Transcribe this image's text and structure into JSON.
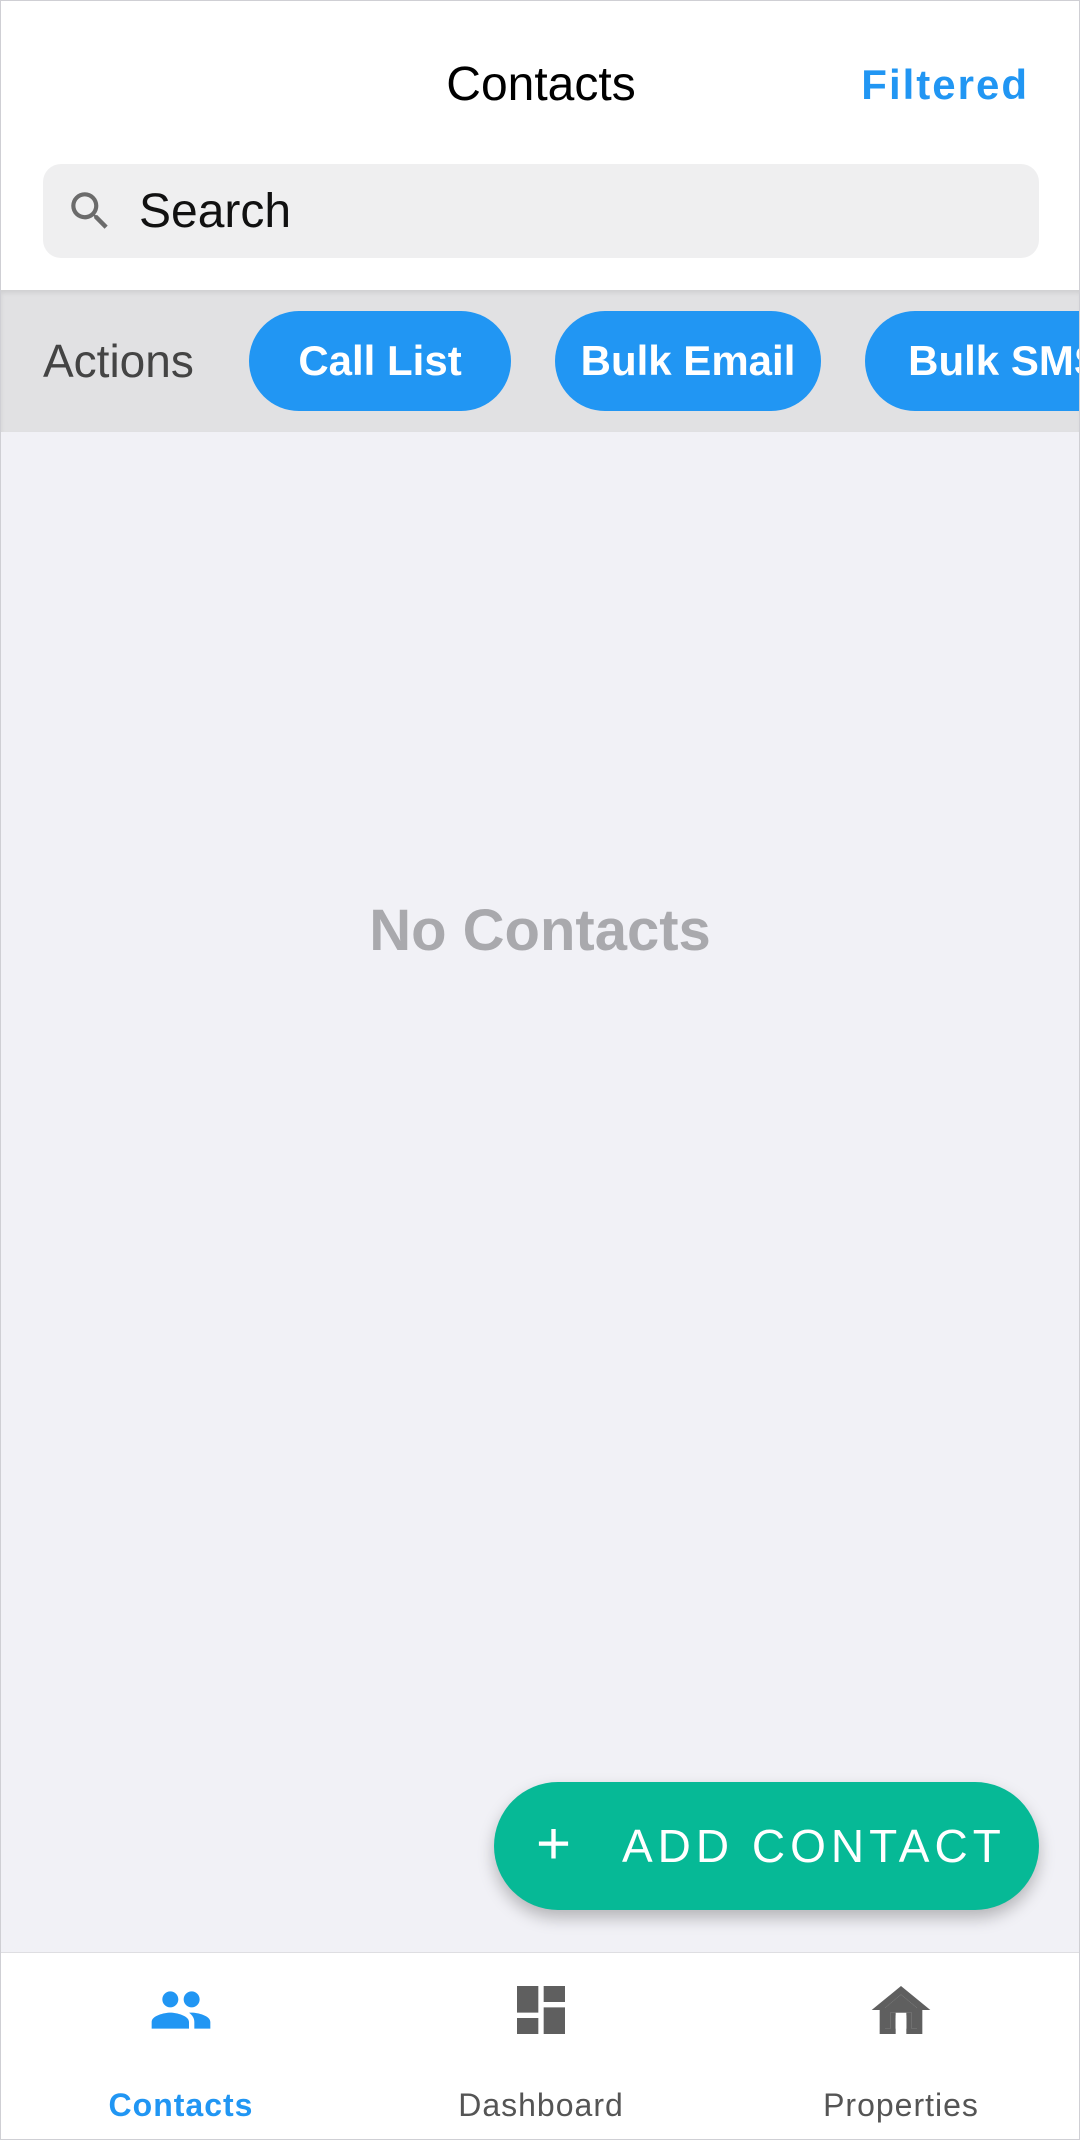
{
  "header": {
    "title": "Contacts",
    "filter_label": "Filtered"
  },
  "search": {
    "placeholder": "Search",
    "value": ""
  },
  "actions": {
    "label": "Actions",
    "buttons": [
      "Call List",
      "Bulk Email",
      "Bulk SMS"
    ]
  },
  "empty_state": {
    "text": "No Contacts"
  },
  "fab": {
    "icon": "plus-icon",
    "label": "ADD CONTACT"
  },
  "bottom_nav": {
    "items": [
      {
        "label": "Contacts",
        "icon": "people-icon",
        "active": true
      },
      {
        "label": "Dashboard",
        "icon": "dashboard-icon",
        "active": false
      },
      {
        "label": "Properties",
        "icon": "home-icon",
        "active": false
      }
    ]
  },
  "colors": {
    "accent_blue": "#2196f3",
    "fab_green": "#06b996",
    "background": "#f1f1f6",
    "empty_text": "#a9a9ad",
    "nav_inactive": "#555555"
  }
}
